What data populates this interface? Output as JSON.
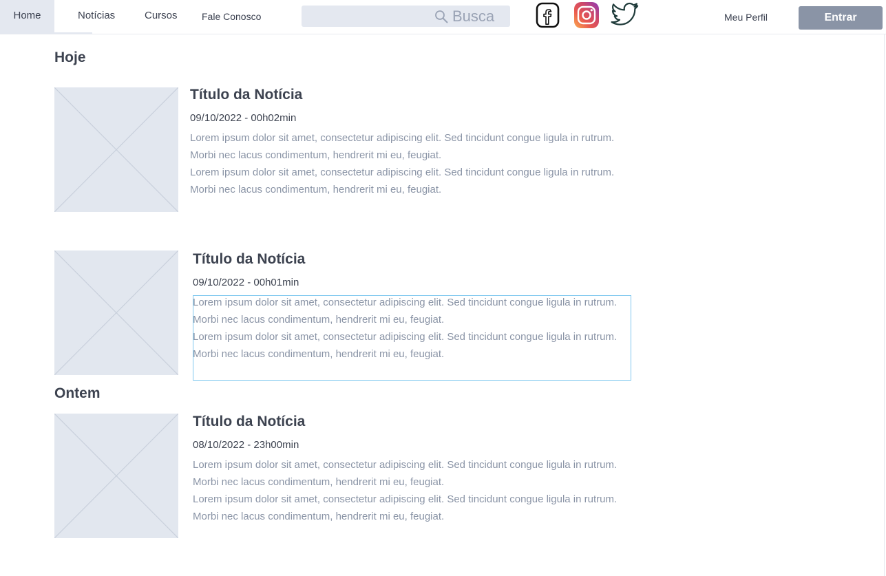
{
  "nav": {
    "home": "Home",
    "noticias": "Notícias",
    "cursos": "Cursos",
    "fale_conosco": "Fale Conosco",
    "meu_perfil": "Meu Perfil"
  },
  "search": {
    "placeholder": "Busca",
    "icon": "search-icon"
  },
  "social": {
    "facebook": "facebook-icon",
    "instagram": "instagram-icon",
    "twitter": "twitter-icon"
  },
  "actions": {
    "entrar": "Entrar"
  },
  "sections": {
    "today": "Hoje",
    "yesterday": "Ontem"
  },
  "news": [
    {
      "title": "Título da Notícia",
      "date": "09/10/2022 - 00h02min",
      "body1": "Lorem ipsum dolor sit amet, consectetur adipiscing elit. Sed tincidunt congue ligula in rutrum. Morbi nec lacus condimentum, hendrerit mi eu, feugiat.",
      "body2": "Lorem ipsum dolor sit amet, consectetur adipiscing elit. Sed tincidunt congue ligula in rutrum. Morbi nec lacus condimentum, hendrerit mi eu, feugiat."
    },
    {
      "title": "Título da Notícia",
      "date": "09/10/2022 - 00h01min",
      "body1": "Lorem ipsum dolor sit amet, consectetur adipiscing elit. Sed tincidunt congue ligula in rutrum. Morbi nec lacus condimentum, hendrerit mi eu, feugiat.",
      "body2": "Lorem ipsum dolor sit amet, consectetur adipiscing elit. Sed tincidunt congue ligula in rutrum. Morbi nec lacus condimentum, hendrerit mi eu, feugiat."
    },
    {
      "title": "Título da Notícia",
      "date": "08/10/2022 - 23h00min",
      "body1": "Lorem ipsum dolor sit amet, consectetur adipiscing elit. Sed tincidunt congue ligula in rutrum. Morbi nec lacus condimentum, hendrerit mi eu, feugiat.",
      "body2": "Lorem ipsum dolor sit amet, consectetur adipiscing elit. Sed tincidunt congue ligula in rutrum. Morbi nec lacus condimentum, hendrerit mi eu, feugiat."
    }
  ],
  "colors": {
    "nav_active_bg": "#e4e8f0",
    "button_bg": "#8a94a6",
    "placeholder_bg": "#e2e7ef",
    "body_text": "#8a94a6",
    "selection_border": "#7cc6ee"
  }
}
